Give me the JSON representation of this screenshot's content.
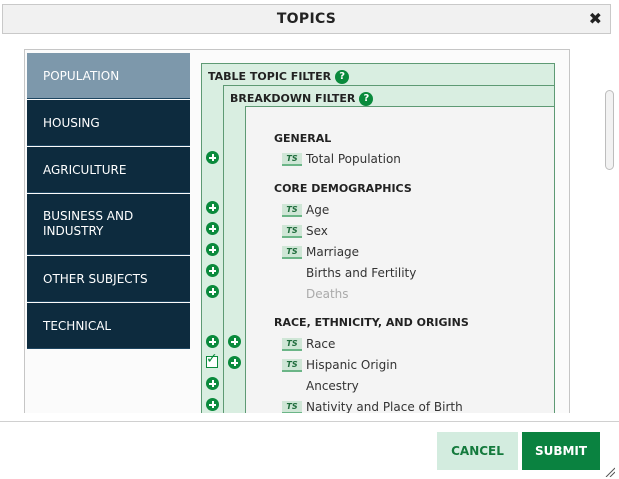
{
  "dialog": {
    "title": "TOPICS",
    "close_glyph": "✖"
  },
  "sidebar": {
    "items": [
      {
        "label": "POPULATION",
        "active": true
      },
      {
        "label": "HOUSING",
        "active": false
      },
      {
        "label": "AGRICULTURE",
        "active": false
      },
      {
        "label": "BUSINESS AND INDUSTRY",
        "active": false
      },
      {
        "label": "OTHER SUBJECTS",
        "active": false
      },
      {
        "label": "TECHNICAL",
        "active": false
      }
    ]
  },
  "filters": {
    "table_topic": "TABLE TOPIC FILTER",
    "breakdown": "BREAKDOWN FILTER",
    "help_glyph": "?"
  },
  "groups": [
    {
      "heading": "GENERAL",
      "rows": [
        {
          "label": "Total Population",
          "ts": true,
          "disabled": false
        }
      ]
    },
    {
      "heading": "CORE DEMOGRAPHICS",
      "rows": [
        {
          "label": "Age",
          "ts": true,
          "disabled": false
        },
        {
          "label": "Sex",
          "ts": true,
          "disabled": false
        },
        {
          "label": "Marriage",
          "ts": true,
          "disabled": false
        },
        {
          "label": "Births and Fertility",
          "ts": false,
          "disabled": false
        },
        {
          "label": "Deaths",
          "ts": false,
          "disabled": true
        }
      ]
    },
    {
      "heading": "RACE, ETHNICITY, AND ORIGINS",
      "rows": [
        {
          "label": "Race",
          "ts": true,
          "disabled": false
        },
        {
          "label": "Hispanic Origin",
          "ts": true,
          "disabled": false
        },
        {
          "label": "Ancestry",
          "ts": false,
          "disabled": false
        },
        {
          "label": "Nativity and Place of Birth",
          "ts": true,
          "disabled": false
        }
      ]
    }
  ],
  "ts_badge": "TS",
  "footer": {
    "cancel_label": "CANCEL",
    "submit_label": "SUBMIT"
  },
  "colors": {
    "navy": "#0d2b3e",
    "active": "#7d98ab",
    "green": "#0a8a3c"
  }
}
